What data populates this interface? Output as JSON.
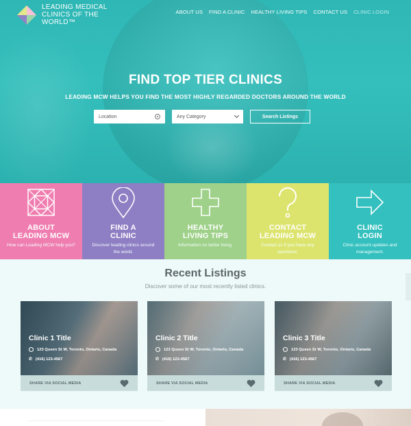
{
  "header": {
    "logo_text": "LEADING MEDICAL CLINICS OF THE WORLD™",
    "nav": [
      {
        "label": "ABOUT US"
      },
      {
        "label": "FIND A CLINIC"
      },
      {
        "label": "HEALTHY LIVING TIPS"
      },
      {
        "label": "CONTACT US"
      },
      {
        "label": "CLINIC LOGIN"
      }
    ]
  },
  "hero": {
    "title": "FIND TOP TIER CLINICS",
    "subtitle": "LEADING MCW HELPS YOU FIND THE MOST HIGHLY REGARDED DOCTORS AROUND THE WORLD",
    "location_placeholder": "Location",
    "category_value": "Any Category",
    "search_label": "Search Listings"
  },
  "tiles": [
    {
      "title_1": "ABOUT",
      "title_2": "LEADING MCW",
      "desc": "How can Leading MCW help you?",
      "color": "#f07db0",
      "icon": "geometric-logo-icon"
    },
    {
      "title_1": "FIND A",
      "title_2": "CLINIC",
      "desc": "Discover leading clinics around the world.",
      "color": "#8e7ec3",
      "icon": "map-pin-icon"
    },
    {
      "title_1": "HEALTHY",
      "title_2": "LIVING TIPS",
      "desc": "Information on better living.",
      "color": "#9fd18a",
      "icon": "plus-icon"
    },
    {
      "title_1": "CONTACT",
      "title_2": "LEADING MCW",
      "desc": "Contact us if you have any questions.",
      "color": "#dde46e",
      "icon": "question-mark-icon"
    },
    {
      "title_1": "CLINIC",
      "title_2": "LOGIN",
      "desc": "Clinic account updates and management.",
      "color": "#33c0be",
      "icon": "arrow-login-icon"
    }
  ],
  "listings": {
    "title": "Recent Listings",
    "subtitle": "Discover some of our most recently listed clinics.",
    "cards": [
      {
        "title": "Clinic 1 Title",
        "address": "123 Queen St W, Toronto, Ontario, Canada",
        "phone": "(416) 123-4567",
        "share": "SHARE VIA SOCIAL MEDIA"
      },
      {
        "title": "Clinic 2 Title",
        "address": "123 Queen St W, Toronto, Ontario, Canada",
        "phone": "(416) 123-4567",
        "share": "SHARE VIA SOCIAL MEDIA"
      },
      {
        "title": "Clinic 3 Title",
        "address": "123 Queen St W, Toronto, Ontario, Canada",
        "phone": "(416) 123-4567",
        "share": "SHARE VIA SOCIAL MEDIA"
      }
    ]
  }
}
